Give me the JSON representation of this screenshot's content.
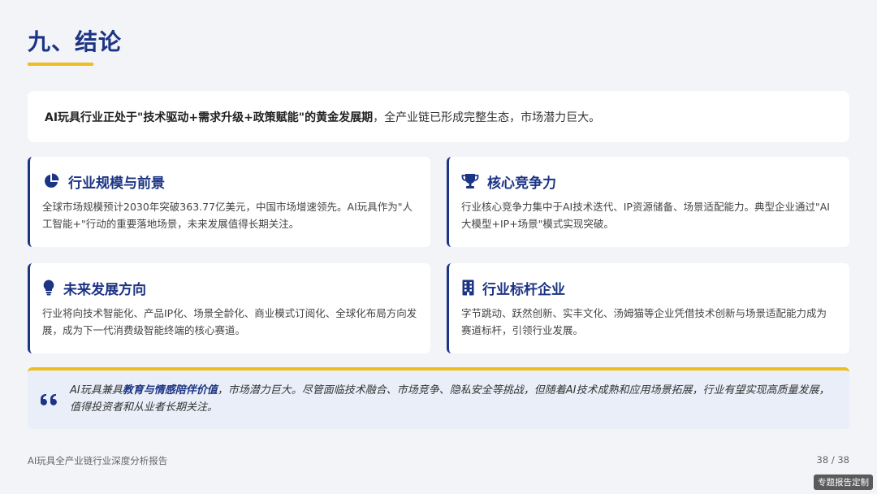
{
  "page": {
    "title": "九、结论"
  },
  "summary": {
    "bold_text": "AI玩具行业正处于\"技术驱动+需求升级+政策赋能\"的黄金发展期",
    "rest_text": "，全产业链已形成完整生态，市场潜力巨大。"
  },
  "cards": [
    {
      "icon": "pie-chart-icon",
      "title": "行业规模与前景",
      "body": "全球市场规模预计2030年突破363.77亿美元，中国市场增速领先。AI玩具作为\"人工智能+\"行动的重要落地场景，未来发展值得长期关注。"
    },
    {
      "icon": "trophy-icon",
      "title": "核心竞争力",
      "body": "行业核心竞争力集中于AI技术迭代、IP资源储备、场景适配能力。典型企业通过\"AI大模型+IP+场景\"模式实现突破。"
    },
    {
      "icon": "lightbulb-icon",
      "title": "未来发展方向",
      "body": "行业将向技术智能化、产品IP化、场景全龄化、商业模式订阅化、全球化布局方向发展，成为下一代消费级智能终端的核心赛道。"
    },
    {
      "icon": "building-icon",
      "title": "行业标杆企业",
      "body": "字节跳动、跃然创新、实丰文化、汤姆猫等企业凭借技术创新与场景适配能力成为赛道标杆，引领行业发展。"
    }
  ],
  "quote": {
    "icon": "quote-icon",
    "prefix": "AI玩具兼具",
    "emphasis": "教育与情感陪伴价值",
    "suffix": "，市场潜力巨大。尽管面临技术融合、市场竞争、隐私安全等挑战，但随着AI技术成熟和应用场景拓展，行业有望实现高质量发展，值得投资者和从业者长期关注。"
  },
  "footer": {
    "report_name": "AI玩具全产业链行业深度分析报告",
    "page_number": "38 / 38"
  },
  "watermark": "专题报告定制",
  "colors": {
    "accent_navy": "#1c3484",
    "accent_yellow": "#efbd21",
    "background": "#f3f4f8"
  }
}
